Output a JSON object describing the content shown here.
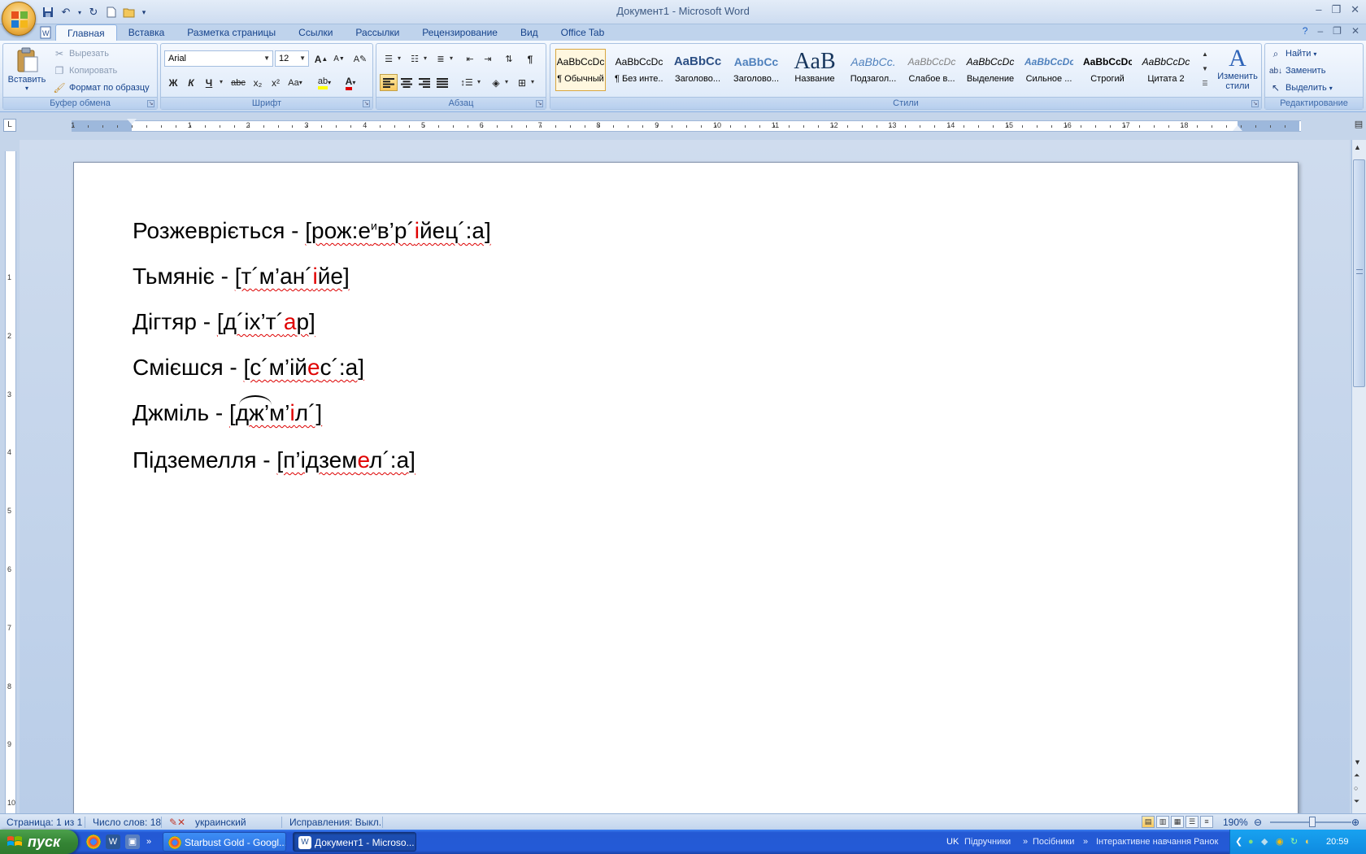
{
  "window": {
    "title": "Документ1 - Microsoft Word"
  },
  "qat": {
    "more": "▾"
  },
  "tabs": [
    {
      "label": "Главная"
    },
    {
      "label": "Вставка"
    },
    {
      "label": "Разметка страницы"
    },
    {
      "label": "Ссылки"
    },
    {
      "label": "Рассылки"
    },
    {
      "label": "Рецензирование"
    },
    {
      "label": "Вид"
    },
    {
      "label": "Office Tab"
    }
  ],
  "ribbon": {
    "clipboard": {
      "label": "Буфер обмена",
      "paste": "Вставить",
      "cut": "Вырезать",
      "copy": "Копировать",
      "format_painter": "Формат по образцу"
    },
    "font": {
      "label": "Шрифт",
      "font_name": "Arial",
      "font_size": "12",
      "bold": "Ж",
      "italic": "К",
      "underline": "Ч",
      "strike": "abc",
      "sub": "x₂",
      "sup": "x²",
      "case": "Aa",
      "grow": "A",
      "shrink": "A"
    },
    "paragraph": {
      "label": "Абзац",
      "pilcrow": "¶"
    },
    "styles": {
      "label": "Стили",
      "items": [
        {
          "preview": "AaBbCcDc",
          "name": "¶ Обычный"
        },
        {
          "preview": "AaBbCcDc",
          "name": "¶ Без инте..."
        },
        {
          "preview": "AaBbCc",
          "name": "Заголово..."
        },
        {
          "preview": "AaBbCc",
          "name": "Заголово..."
        },
        {
          "preview": "AaB",
          "name": "Название"
        },
        {
          "preview": "AaBbCc.",
          "name": "Подзагол..."
        },
        {
          "preview": "AaBbCcDc",
          "name": "Слабое в..."
        },
        {
          "preview": "AaBbCcDc",
          "name": "Выделение"
        },
        {
          "preview": "AaBbCcDc",
          "name": "Сильное ..."
        },
        {
          "preview": "AaBbCcDc",
          "name": "Строгий"
        },
        {
          "preview": "AaBbCcDc",
          "name": "Цитата 2"
        }
      ],
      "change_styles": "Изменить стили"
    },
    "editing": {
      "label": "Редактирование",
      "find": "Найти",
      "replace": "Заменить",
      "select": "Выделить"
    }
  },
  "ruler": {
    "h_numbers": [
      "1",
      "1",
      "2",
      "3",
      "4",
      "5",
      "6",
      "7",
      "8",
      "9",
      "10",
      "11",
      "12",
      "13",
      "14",
      "15",
      "16",
      "17",
      "18"
    ],
    "v_numbers": [
      "1",
      "2",
      "3",
      "4",
      "5",
      "6",
      "7",
      "8",
      "9",
      "10"
    ]
  },
  "document": {
    "lines": [
      {
        "word": "Розжевріється",
        "pre": "[рож:е",
        "sup": "и",
        "mid": "в’р´",
        "red": "і",
        "post": "йец´:а]"
      },
      {
        "word": "Тьмяніє",
        "pre": "[т´м’ан´",
        "red": "і",
        "post": "йе]"
      },
      {
        "word": "Дігтяр",
        "pre": "[д´іх’т´",
        "red": "а",
        "post": "р]"
      },
      {
        "word": "Смієшся",
        "pre": "[с´м’ій",
        "red": "е",
        "post": "с´:а]"
      },
      {
        "word": "Джміль",
        "pre": "[дж’м’",
        "red": "і",
        "post": "л´]"
      },
      {
        "word": "Підземелля",
        "pre": "[п’ідзем",
        "red": "е",
        "post": "л´:а]"
      }
    ],
    "dash": " - "
  },
  "status": {
    "page": "Страница: 1 из 1",
    "words": "Число слов: 18",
    "language": "украинский",
    "track": "Исправления: Выкл.",
    "zoom": "190%",
    "zoom_fraction": 0.52
  },
  "taskbar": {
    "start": "пуск",
    "tasks": [
      {
        "label": "Starbust Gold - Googl..."
      },
      {
        "label": "Документ1 - Microso..."
      }
    ],
    "lang": "UK",
    "toolbars": [
      "Підручники",
      "Посібники",
      "Інтерактивне навчання Ранок"
    ],
    "clock": "20:59"
  },
  "colors": {
    "accent": "#15428b",
    "ribbon": "#dbe7f6",
    "taskbar": "#245ad6",
    "spell": "#dd0000",
    "stress": "#e00000"
  }
}
